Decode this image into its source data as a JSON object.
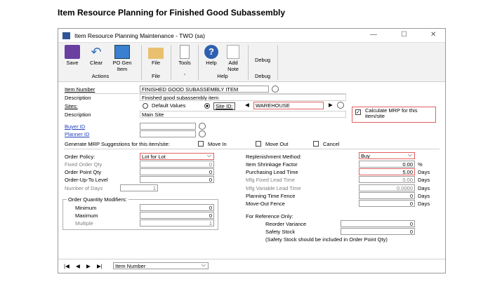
{
  "heading": "Item Resource Planning for Finished Good Subassembly",
  "window": {
    "title": "Item Resource Planning Maintenance  -  TWO (sa)"
  },
  "ribbon": {
    "save": "Save",
    "clear": "Clear",
    "po_gen": "PO Gen",
    "po_gen2": "Item",
    "file": "File",
    "tools": "Tools",
    "help": "Help",
    "add_note": "Add",
    "add_note2": "Note",
    "debug": "Debug",
    "groups": {
      "actions": "Actions",
      "file": "File",
      "tools": "ˇ",
      "help": "Help",
      "debug": "Debug"
    }
  },
  "form": {
    "item_number_label": "Item Number",
    "item_number": "FINISHED GOOD SUBASSEMBLY ITEM",
    "description_label": "Description",
    "description": "Finished good subassembly item",
    "sites_label": "Sites:",
    "default_values": "Default Values",
    "site_id": "Site ID:",
    "site_value": "WAREHOUSE",
    "site_desc_label": "Description",
    "site_desc": "Main Site",
    "calc_mrp": "Calculate MRP for this item/site",
    "buyer_id": "Buyer ID",
    "planner_id": "Planner ID",
    "generate_label": "Generate MRP Suggestions for this item/site:",
    "move_in": "Move In",
    "move_out": "Move Out",
    "cancel": "Cancel",
    "order_policy_label": "Order Policy:",
    "order_policy": "Lot for Lot",
    "fixed_order_qty_label": "Fixed Order Qty",
    "fixed_order_qty": "0",
    "order_point_qty_label": "Order Point Qty",
    "order_point_qty": "0",
    "order_up_to_label": "Order-Up-To Level",
    "order_up_to": "0",
    "num_days_label": "Number of Days",
    "num_days": "1",
    "oqm_label": "Order Quantity Modifiers:",
    "minimum_label": "Minimum",
    "minimum": "0",
    "maximum_label": "Maximum",
    "maximum": "0",
    "multiple_label": "Multiple",
    "multiple": "1",
    "replenish_label": "Replenishment Method:",
    "replenish": "Buy",
    "shrink_label": "Item Shrinkage Factor",
    "shrink": "0.00",
    "pct": "%",
    "purch_lead_label": "Purchasing Lead Time",
    "purch_lead": "5.00",
    "mfg_fixed_label": "Mfg Fixed Lead Time",
    "mfg_fixed": "0.00",
    "mfg_var_label": "Mfg Variable Lead Time",
    "mfg_var": "0.0000",
    "plan_fence_label": "Planning Time Fence",
    "plan_fence": "0",
    "moveout_fence_label": "Move-Out Fence",
    "moveout_fence": "0",
    "days": "Days",
    "ref_only": "For Reference Only:",
    "reorder_var_label": "Reorder Variance",
    "reorder_var": "0",
    "safety_label": "Safety Stock",
    "safety": "0",
    "safety_note": "(Safety Stock should be included in Order Point Qty)"
  },
  "footer": {
    "sort": "Item Number"
  }
}
